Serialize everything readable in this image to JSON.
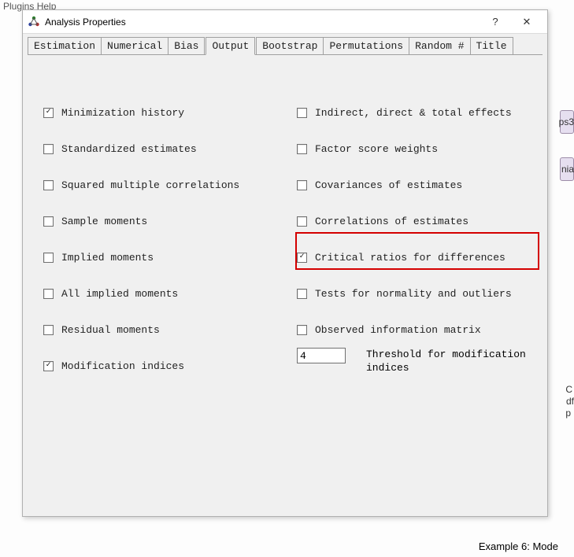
{
  "background": {
    "menu_hint": "Plugins   Help",
    "footer": "Example 6: Mode",
    "frag1": "ps3",
    "frag2": "nia",
    "frag3": "C",
    "frag4": "df",
    "frag5": "p"
  },
  "dialog": {
    "title": "Analysis Properties",
    "help_symbol": "?",
    "close_symbol": "✕",
    "tabs": [
      {
        "label": "Estimation"
      },
      {
        "label": "Numerical"
      },
      {
        "label": "Bias"
      },
      {
        "label": "Output"
      },
      {
        "label": "Bootstrap"
      },
      {
        "label": "Permutations"
      },
      {
        "label": "Random #"
      },
      {
        "label": "Title"
      }
    ],
    "active_tab": "Output",
    "left": [
      {
        "label": "Minimization history",
        "checked": true
      },
      {
        "label": "Standardized estimates",
        "checked": false
      },
      {
        "label": "Squared multiple correlations",
        "checked": false
      },
      {
        "label": "Sample moments",
        "checked": false
      },
      {
        "label": "Implied moments",
        "checked": false
      },
      {
        "label": "All implied moments",
        "checked": false
      },
      {
        "label": "Residual moments",
        "checked": false
      },
      {
        "label": "Modification indices",
        "checked": true
      }
    ],
    "right": [
      {
        "label": "Indirect, direct & total effects",
        "checked": false
      },
      {
        "label": "Factor score weights",
        "checked": false
      },
      {
        "label": "Covariances of estimates",
        "checked": false
      },
      {
        "label": "Correlations of estimates",
        "checked": false
      },
      {
        "label": "Critical ratios for differences",
        "checked": true
      },
      {
        "label": "Tests for normality and outliers",
        "checked": false
      },
      {
        "label": "Observed information matrix",
        "checked": false
      }
    ],
    "threshold": {
      "value": "4",
      "label": "Threshold for modification indices"
    }
  }
}
